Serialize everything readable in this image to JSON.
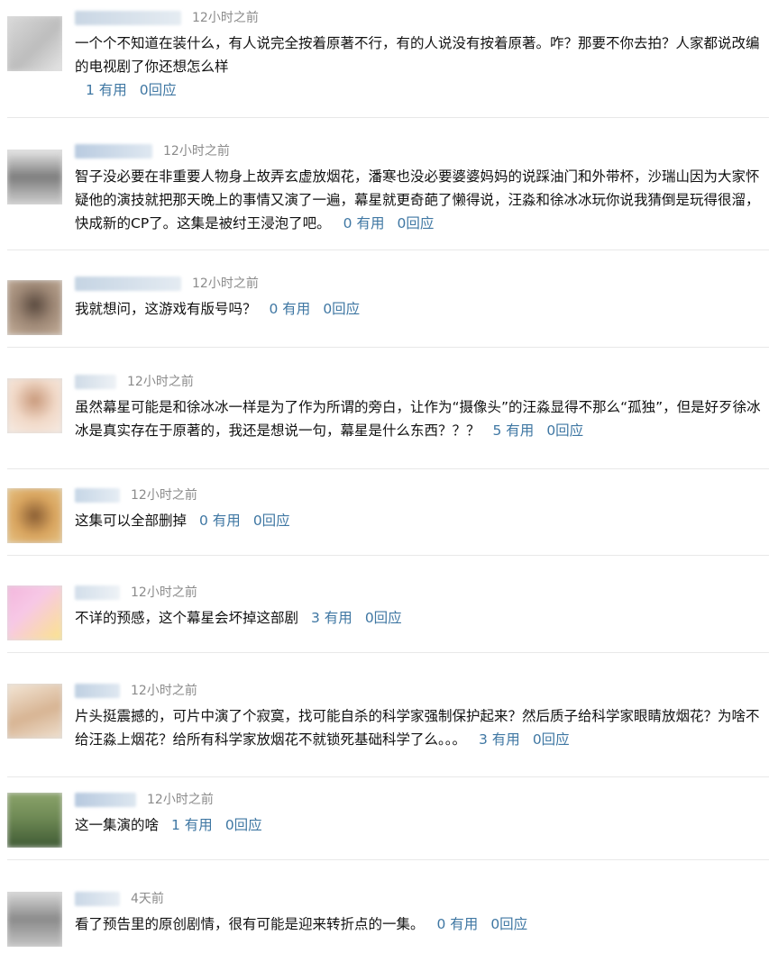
{
  "comments": [
    {
      "time": "12小时之前",
      "text": "一个个不知道在装什么，有人说完全按着原著不行，有的人说没有按着原著。咋？那要不你去拍？人家都说改编的电视剧了你还想怎么样",
      "useful": "1 有用",
      "reply": "0回应",
      "avatar_colors": [
        "#d9d9d9",
        "#bdbdbd",
        "#e6e6e6"
      ],
      "username_colors": [
        "#c9d6e4",
        "#e5ecf2"
      ]
    },
    {
      "time": "12小时之前",
      "text": "智子没必要在非重要人物身上故弄玄虚放烟花，潘寒也没必要婆婆妈妈的说踩油门和外带杯，沙瑞山因为大家怀疑他的演技就把那天晚上的事情又演了一遍，幕星就更奇葩了懒得说，汪淼和徐冰冰玩你说我猜倒是玩得很溜，快成新的CP了。这集是被纣王浸泡了吧。",
      "useful": "0 有用",
      "reply": "0回应",
      "avatar_colors": [
        "#e8e8e8",
        "#7d7d7d",
        "#cfcfcf"
      ],
      "username_colors": [
        "#b9cbe0",
        "#dfe8f1"
      ]
    },
    {
      "time": "12小时之前",
      "text": "我就想问，这游戏有版号吗？",
      "useful": "0 有用",
      "reply": "0回应",
      "avatar_colors": [
        "#c7b19c",
        "#5a4a3f",
        "#9c8674"
      ],
      "username_colors": [
        "#c5d4e3",
        "#e4ebf2"
      ]
    },
    {
      "time": "12小时之前",
      "text": "虽然幕星可能是和徐冰冰一样是为了作为所谓的旁白，让作为“摄像头”的汪淼显得不那么“孤独”，但是好歹徐冰冰是真实存在于原著的，我还是想说一句，幕星是什么东西？？？",
      "useful": "5 有用",
      "reply": "0回应",
      "avatar_colors": [
        "#f1d9c8",
        "#c99a7c",
        "#f7ece4"
      ],
      "username_colors": [
        "#cfdbe7",
        "#eef2f6"
      ]
    },
    {
      "time": "12小时之前",
      "text": "这集可以全部删掉",
      "useful": "0 有用",
      "reply": "0回应",
      "avatar_colors": [
        "#e7c486",
        "#8a5e34",
        "#d8a45e"
      ],
      "username_colors": [
        "#c6d6e6",
        "#e6edf4"
      ]
    },
    {
      "time": "12小时之前",
      "text": "不详的预感，这个幕星会坏掉这部剧",
      "useful": "3 有用",
      "reply": "0回应",
      "avatar_colors": [
        "#f3b6dc",
        "#fbe48a",
        "#f7c8e6"
      ],
      "username_colors": [
        "#d2deea",
        "#eef2f6"
      ]
    },
    {
      "time": "12小时之前",
      "text": "片头挺震撼的，可片中演了个寂寞，找可能自杀的科学家强制保护起来？然后质子给科学家眼睛放烟花？为啥不给汪淼上烟花？给所有科学家放烟花不就锁死基础科学了么。。。",
      "useful": "3 有用",
      "reply": "0回应",
      "avatar_colors": [
        "#f3e6d6",
        "#d7b493",
        "#efe0cf"
      ],
      "username_colors": [
        "#bfd0e2",
        "#dfe8f1"
      ]
    },
    {
      "time": "12小时之前",
      "text": "这一集演的啥",
      "useful": "1 有用",
      "reply": "0回应",
      "avatar_colors": [
        "#6f8a55",
        "#3f5a34",
        "#8aa36a"
      ],
      "username_colors": [
        "#b7c9df",
        "#dde7f0"
      ]
    },
    {
      "time": "4天前",
      "text": "看了预告里的原创剧情，很有可能是迎来转折点的一集。",
      "useful": "0 有用",
      "reply": "0回应",
      "avatar_colors": [
        "#d8d8d8",
        "#8a8a8a",
        "#c4c4c4"
      ],
      "username_colors": [
        "#c9d7e6",
        "#e8eef4"
      ]
    }
  ]
}
